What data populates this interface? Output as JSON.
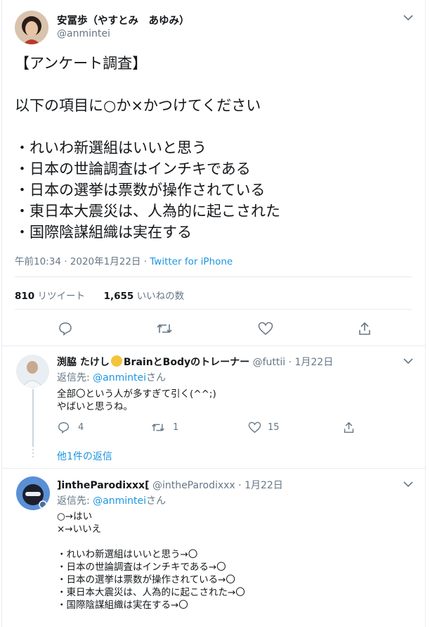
{
  "main_tweet": {
    "author_name": "安冨歩（やすとみ　あゆみ）",
    "author_handle": "@anmintei",
    "lines": [
      "【アンケート調査】",
      "",
      "以下の項目に○か×かつけてください",
      "",
      "・れいわ新選組はいいと思う",
      "・日本の世論調査はインチキである",
      "・日本の選挙は票数が操作されている",
      "・東日本大震災は、人為的に起こされた",
      "・国際陰謀組織は実在する"
    ],
    "meta_time": "午前10:34 · 2020年1月22日 · ",
    "meta_source": "Twitter for iPhone",
    "retweet_count": "810",
    "retweet_label": "リツイート",
    "like_count": "1,655",
    "like_label": "いいねの数"
  },
  "reply1": {
    "author_name_a": "渕脇 たけし",
    "author_name_b": "BrainとBodyのトレーナー",
    "author_handle": "@futtii",
    "date": "· 1月22日",
    "reply_to_label": "返信先: ",
    "reply_to_handle": "@anmintei",
    "reply_to_suffix": "さん",
    "lines": [
      "全部〇という人が多すぎて引く(^^;)",
      "やばいと思うね。"
    ],
    "reply_count": "4",
    "retweet_count": "1",
    "like_count": "15",
    "more_replies": "他1件の返信"
  },
  "reply2": {
    "author_name": "]intheParodixxx[",
    "author_handle": "@intheParodixxx",
    "date": "· 1月22日",
    "reply_to_label": "返信先: ",
    "reply_to_handle": "@anmintei",
    "reply_to_suffix": "さん",
    "lines": [
      "○→はい",
      "×→いいえ",
      "",
      "・れいわ新選組はいいと思う→〇",
      "・日本の世論調査はインチキである→〇",
      "・日本の選挙は票数が操作されている→〇",
      "・東日本大震災は、人為的に起こされた→〇",
      "・国際陰謀組織は実在する→〇"
    ]
  },
  "colors": {
    "link": "#1b95e0",
    "muted": "#657786",
    "border": "#e6ecf0"
  }
}
